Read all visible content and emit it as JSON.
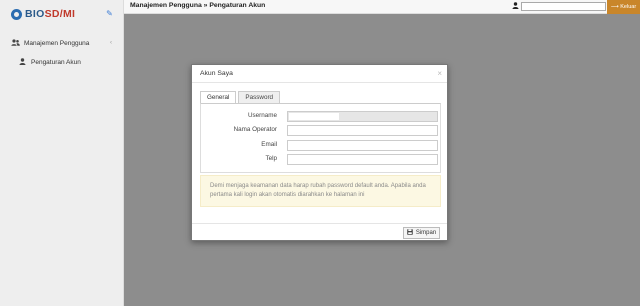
{
  "sidebar": {
    "logo": {
      "prefix": "BIO",
      "accent": "SD/MI"
    },
    "items": [
      {
        "label": "Manajemen Pengguna",
        "icon": "users-icon"
      },
      {
        "label": "Pengaturan Akun",
        "icon": "user-icon"
      }
    ]
  },
  "topbar": {
    "breadcrumb": "Manajemen Pengguna » Pengaturan Akun",
    "logout_label": "⟶ Keluar"
  },
  "modal": {
    "title": "Akun Saya",
    "close_glyph": "×",
    "tabs": [
      {
        "label": "General",
        "active": true
      },
      {
        "label": "Password",
        "active": false
      }
    ],
    "fields": [
      {
        "label": "Username",
        "value": ""
      },
      {
        "label": "Nama Operator",
        "value": ""
      },
      {
        "label": "Email",
        "value": ""
      },
      {
        "label": "Telp",
        "value": ""
      }
    ],
    "alert_text": "Demi menjaga keamanan data harap rubah password default anda. Apabila anda pertama kali login akan otomatis diarahkan ke halaman ini",
    "save_label": "Simpan"
  },
  "colors": {
    "accent": "#c9862a",
    "logo_blue": "#2b5a8a",
    "logo_red": "#c0392b",
    "overlay": "#8d8d8d",
    "alert_bg": "#fcf8e3"
  }
}
